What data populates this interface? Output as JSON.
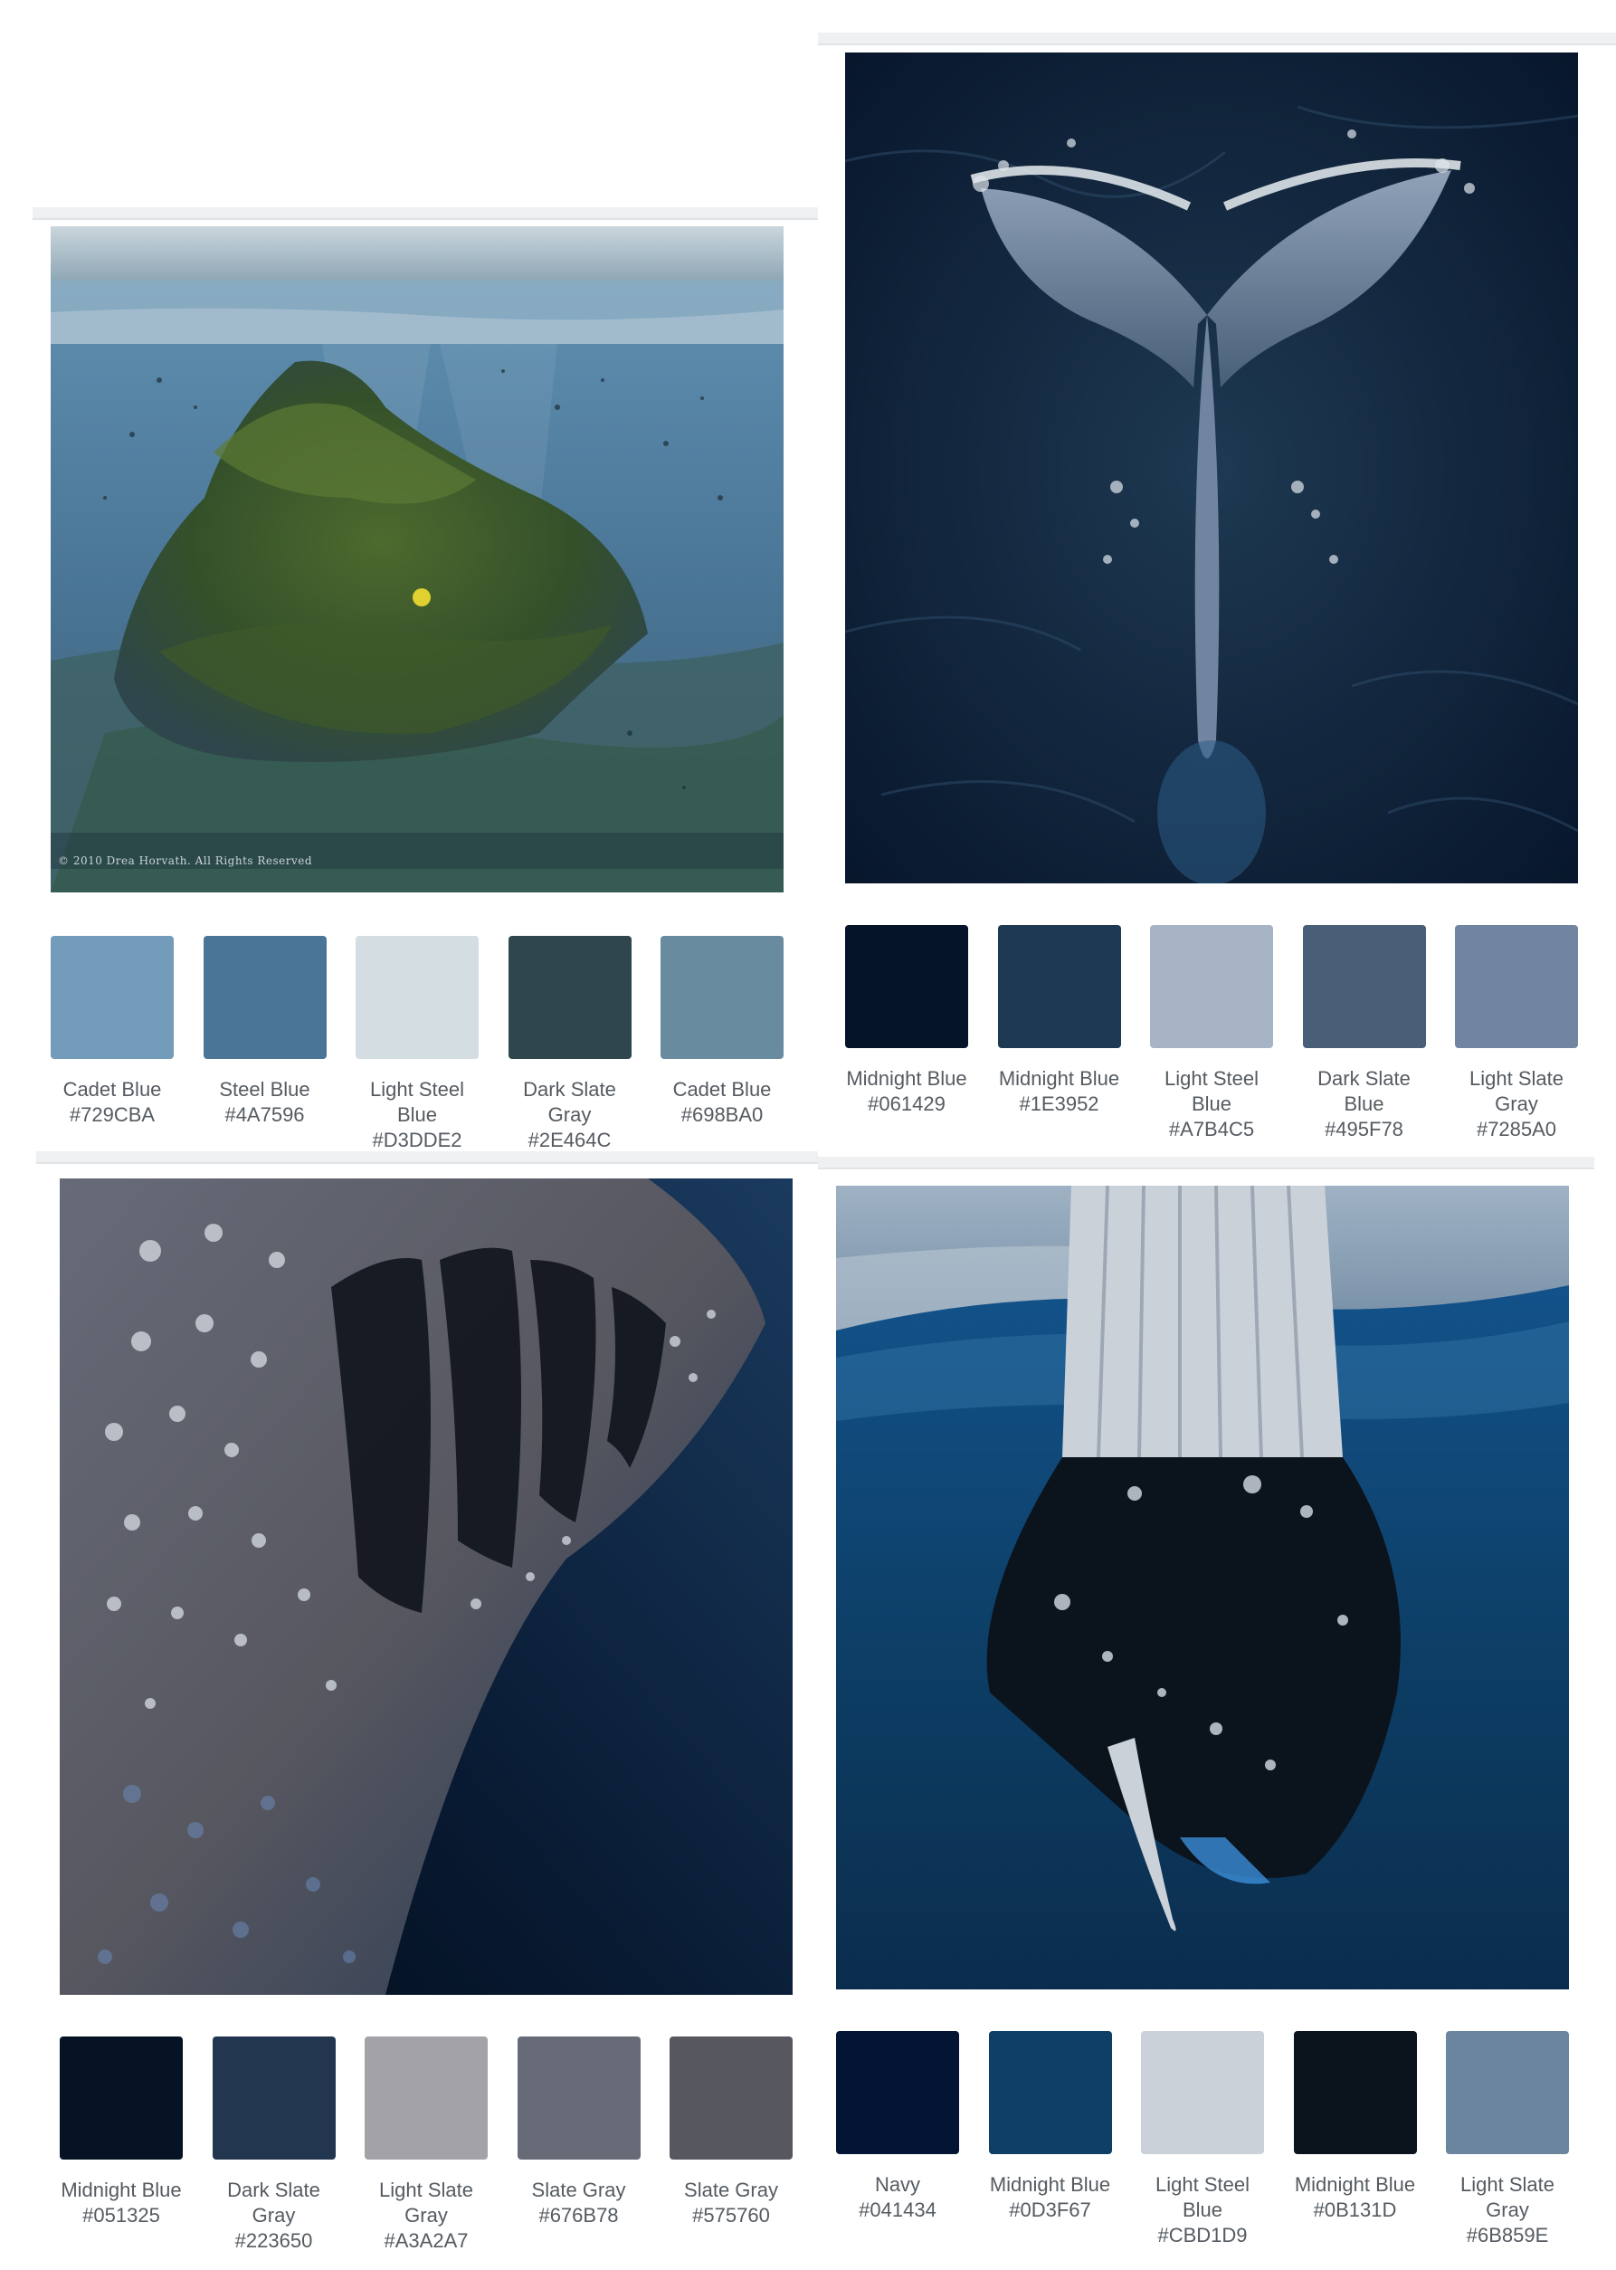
{
  "cards": [
    {
      "id": "coral-rock",
      "copyright": "© 2010 Drea Horvath. All Rights Reserved",
      "swatches": [
        {
          "name": "Cadet Blue",
          "hex": "#729CBA"
        },
        {
          "name": "Steel Blue",
          "hex": "#4A7596"
        },
        {
          "name": "Light Steel Blue",
          "hex": "#D3DDE2"
        },
        {
          "name": "Dark Slate Gray",
          "hex": "#2E464C"
        },
        {
          "name": "Cadet Blue",
          "hex": "#698BA0"
        }
      ]
    },
    {
      "id": "whale-tail",
      "swatches": [
        {
          "name": "Midnight Blue",
          "hex": "#061429"
        },
        {
          "name": "Midnight Blue",
          "hex": "#1E3952"
        },
        {
          "name": "Light Steel Blue",
          "hex": "#A7B4C5"
        },
        {
          "name": "Dark Slate Blue",
          "hex": "#495F78"
        },
        {
          "name": "Light Slate Gray",
          "hex": "#7285A0"
        }
      ]
    },
    {
      "id": "whale-shark",
      "swatches": [
        {
          "name": "Midnight Blue",
          "hex": "#051325"
        },
        {
          "name": "Dark Slate Gray",
          "hex": "#223650"
        },
        {
          "name": "Light Slate Gray",
          "hex": "#A3A2A7"
        },
        {
          "name": "Slate Gray",
          "hex": "#676B78"
        },
        {
          "name": "Slate Gray",
          "hex": "#575760"
        }
      ]
    },
    {
      "id": "humpback",
      "swatches": [
        {
          "name": "Navy",
          "hex": "#041434"
        },
        {
          "name": "Midnight Blue",
          "hex": "#0D3F67"
        },
        {
          "name": "Light Steel Blue",
          "hex": "#CBD1D9"
        },
        {
          "name": "Midnight Blue",
          "hex": "#0B131D"
        },
        {
          "name": "Light Slate Gray",
          "hex": "#6B859E"
        }
      ]
    }
  ]
}
